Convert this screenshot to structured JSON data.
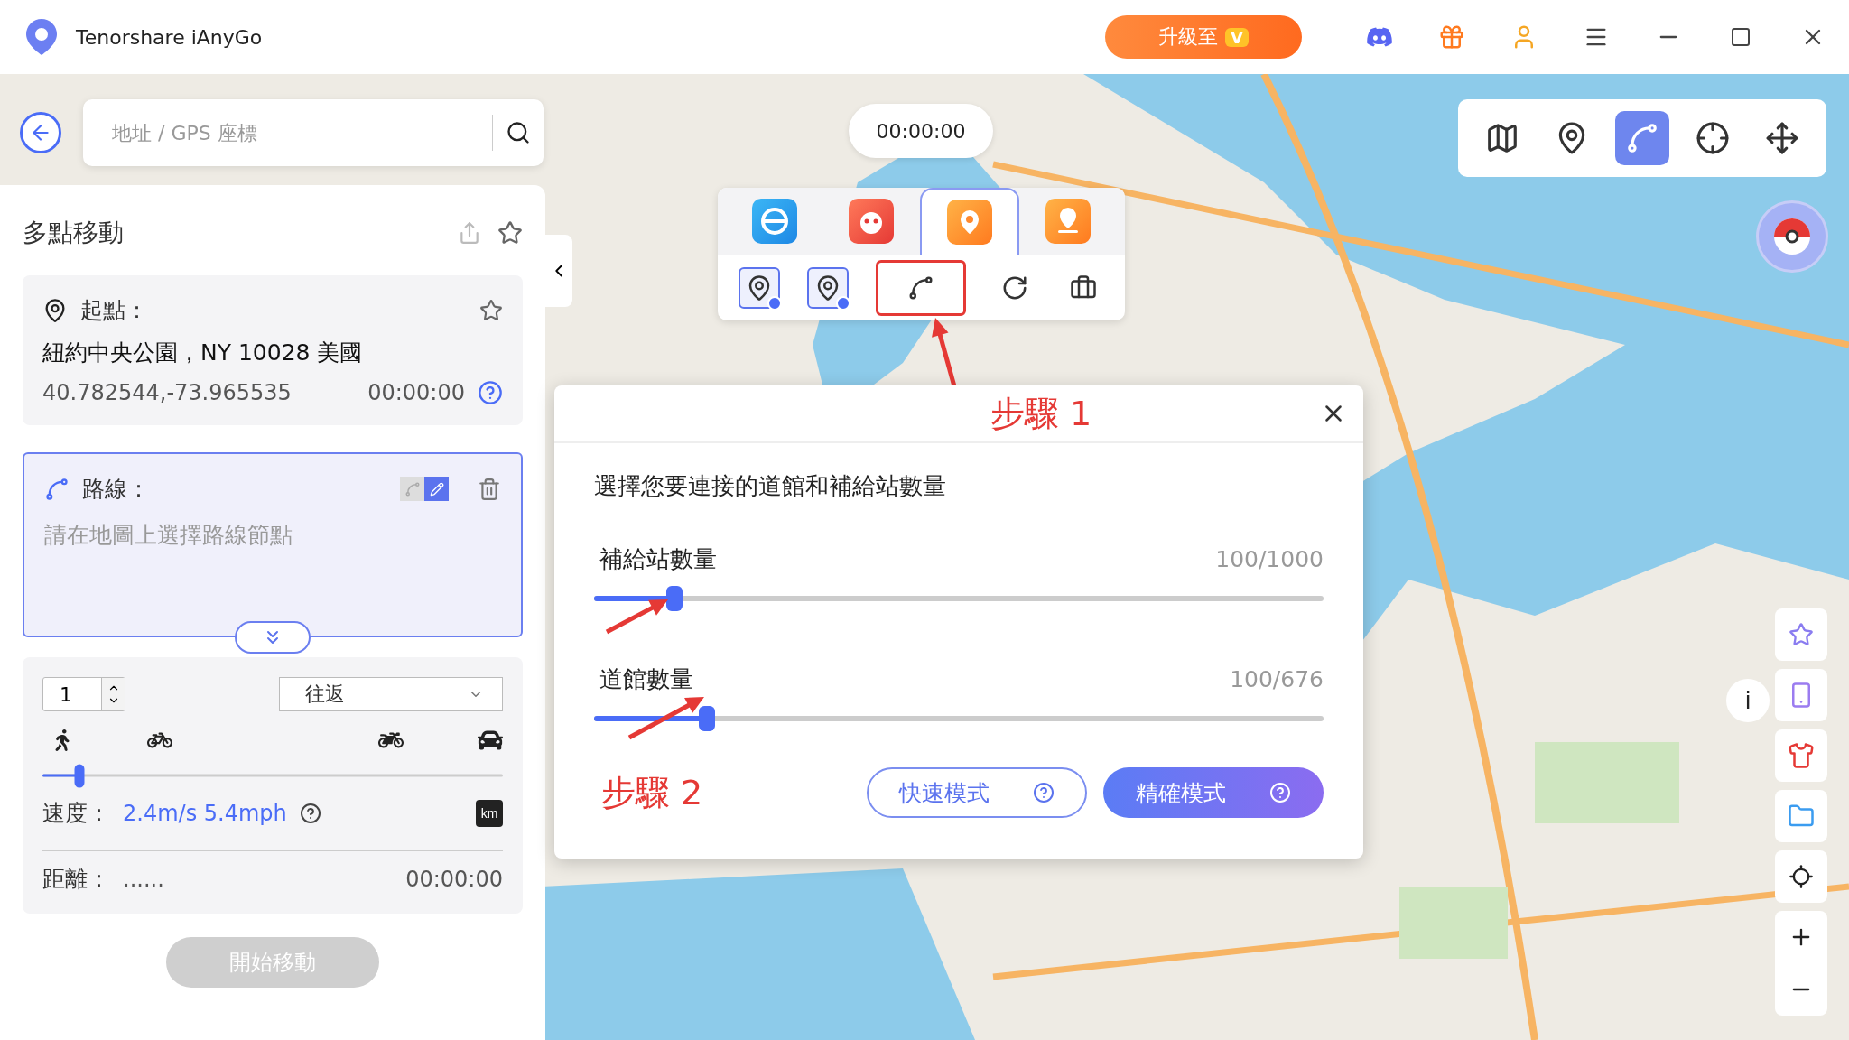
{
  "app": {
    "title": "Tenorshare iAnyGo",
    "upgrade_button": "升級至",
    "upgrade_badge": "V"
  },
  "search": {
    "placeholder": "地址 / GPS 座標"
  },
  "panel": {
    "title": "多點移動",
    "start": {
      "label": "起點：",
      "address": "紐約中央公園，NY  10028 美國",
      "coords": "40.782544,-73.965535",
      "time": "00:00:00"
    },
    "route": {
      "label": "路線：",
      "placeholder": "請在地圖上選擇路線節點",
      "modes": [
        {
          "kind": "curve",
          "selected": false
        },
        {
          "kind": "straight",
          "selected": true
        }
      ]
    },
    "repeat": {
      "count": "1",
      "mode": "往返"
    },
    "speed": {
      "label": "速度：",
      "value": "2.4m/s 5.4mph",
      "level": 0.08,
      "unit_km": true,
      "unit": "km"
    },
    "distance": {
      "label": "距離：",
      "value": "......",
      "time": "00:00:00"
    },
    "start_button": {
      "label": "開始移動",
      "disabled": true
    }
  },
  "timer": "00:00:00",
  "game_tabs": [
    {
      "kind": "ball",
      "selected": false
    },
    {
      "kind": "monster",
      "selected": false
    },
    {
      "kind": "orange-pin",
      "selected": true
    },
    {
      "kind": "purple-pin",
      "selected": false
    }
  ],
  "tools": [
    {
      "kind": "gym",
      "checked": true,
      "highlighted": false
    },
    {
      "kind": "stop",
      "checked": true,
      "highlighted": false
    },
    {
      "kind": "route",
      "checked": false,
      "highlighted": true
    },
    {
      "kind": "refresh",
      "checked": false,
      "highlighted": false
    },
    {
      "kind": "bag",
      "checked": false,
      "highlighted": false
    }
  ],
  "dialog": {
    "prompt": "選擇您要連接的道館和補給站數量",
    "sliders": [
      {
        "label": "補給站數量",
        "reading": "100/1000",
        "level": 0.11
      },
      {
        "label": "道館數量",
        "reading": "100/676",
        "level": 0.155
      }
    ],
    "buttons": [
      {
        "label": "快速模式",
        "selected": false
      },
      {
        "label": "精確模式",
        "selected": true
      }
    ]
  },
  "annotations": {
    "step_1": "步驟 1",
    "step_2": "步驟 2"
  },
  "toolbar": [
    {
      "kind": "teleport",
      "selected": false
    },
    {
      "kind": "two-spot",
      "selected": false
    },
    {
      "kind": "multi-spot",
      "selected": true
    },
    {
      "kind": "jump",
      "selected": false
    },
    {
      "kind": "joystick",
      "selected": false
    }
  ],
  "info_button": "i"
}
